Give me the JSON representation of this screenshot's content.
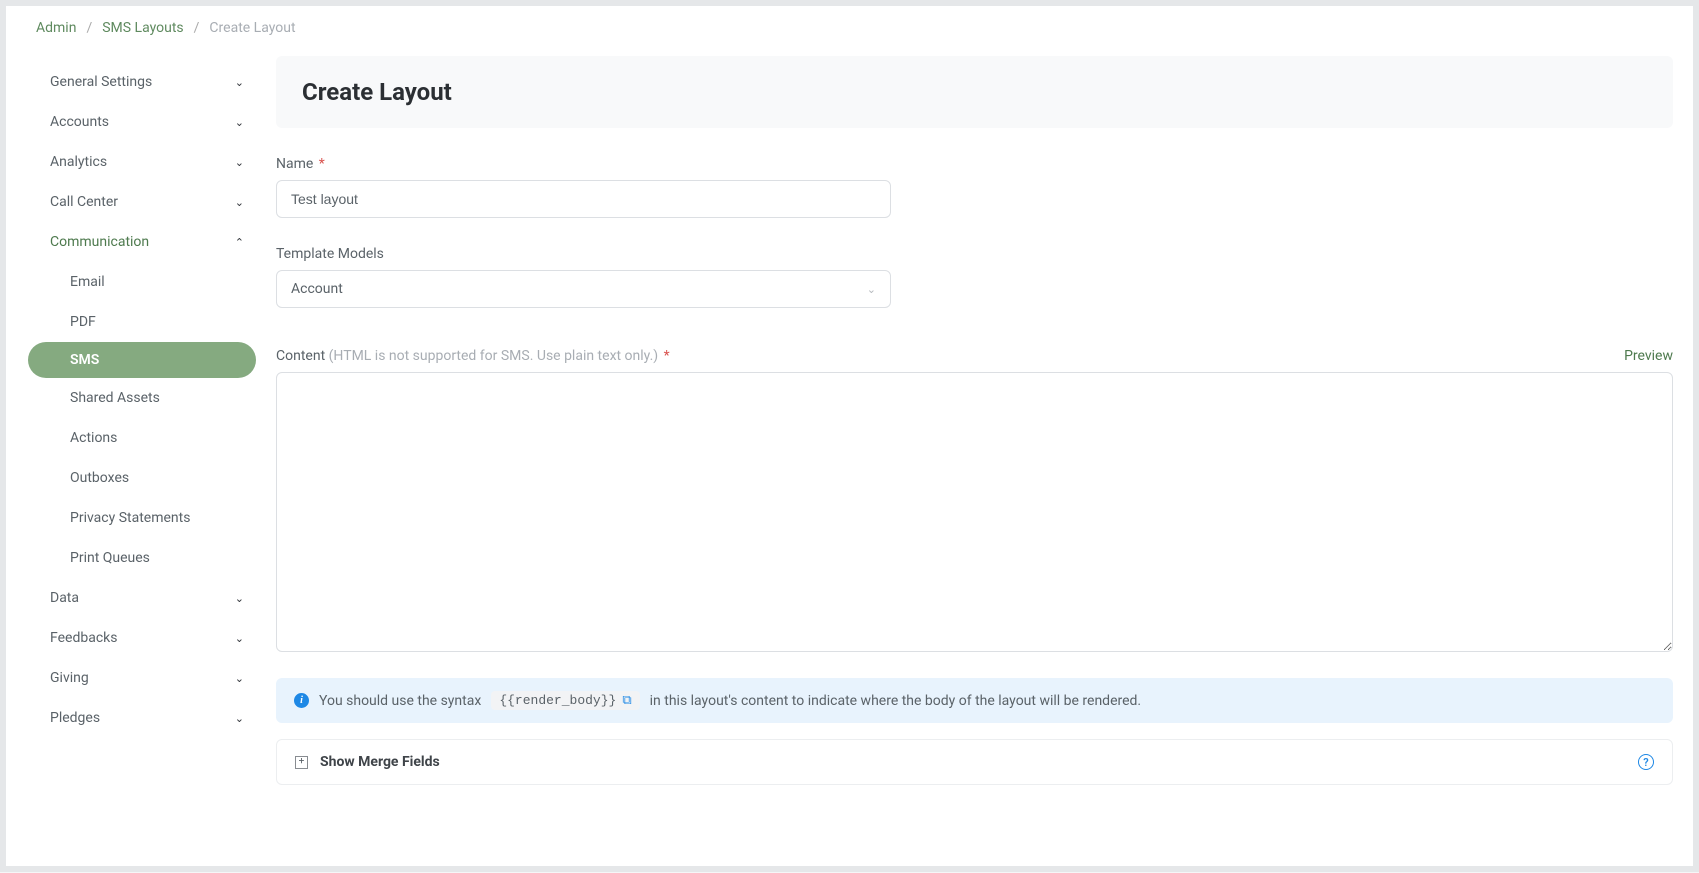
{
  "breadcrumb": {
    "admin": "Admin",
    "sms_layouts": "SMS Layouts",
    "current": "Create Layout"
  },
  "sidebar": {
    "items": [
      {
        "label": "General Settings",
        "expanded": false
      },
      {
        "label": "Accounts",
        "expanded": false
      },
      {
        "label": "Analytics",
        "expanded": false
      },
      {
        "label": "Call Center",
        "expanded": false
      },
      {
        "label": "Communication",
        "expanded": true
      },
      {
        "label": "Data",
        "expanded": false
      },
      {
        "label": "Feedbacks",
        "expanded": false
      },
      {
        "label": "Giving",
        "expanded": false
      },
      {
        "label": "Pledges",
        "expanded": false
      }
    ],
    "communication_sub": [
      {
        "label": "Email",
        "active": false
      },
      {
        "label": "PDF",
        "active": false
      },
      {
        "label": "SMS",
        "active": true
      },
      {
        "label": "Shared Assets",
        "active": false
      },
      {
        "label": "Actions",
        "active": false
      },
      {
        "label": "Outboxes",
        "active": false
      },
      {
        "label": "Privacy Statements",
        "active": false
      },
      {
        "label": "Print Queues",
        "active": false
      }
    ]
  },
  "main": {
    "title": "Create Layout",
    "name_label": "Name",
    "name_value": "Test layout",
    "template_label": "Template Models",
    "template_value": "Account",
    "content_label": "Content",
    "content_hint": "(HTML is not supported for SMS. Use plain text only.)",
    "content_value": "",
    "preview": "Preview",
    "info_pre": "You should use the syntax",
    "info_code": "{{render_body}}",
    "info_post": "in this layout's content to indicate where the body of the layout will be rendered.",
    "merge_title": "Show Merge Fields"
  }
}
